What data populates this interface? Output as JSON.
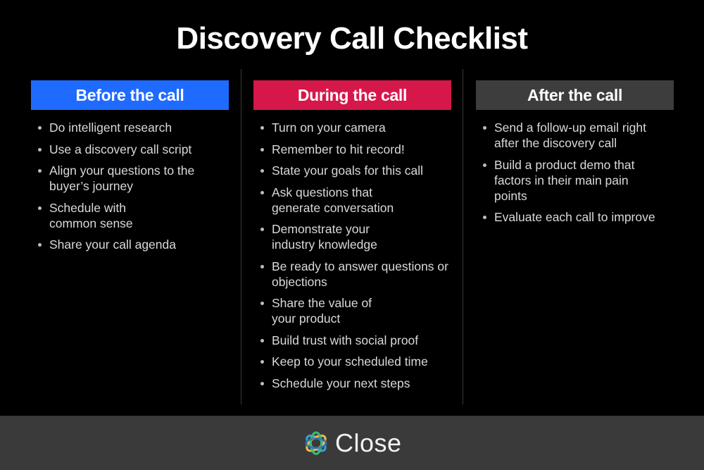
{
  "title": "Discovery Call Checklist",
  "colors": {
    "before": "#1f6bff",
    "during": "#d6174a",
    "after": "#3d3d3d",
    "footer": "#3a3a3a"
  },
  "columns": [
    {
      "heading": "Before the call",
      "items": [
        "Do intelligent research",
        "Use a discovery call script",
        "Align your questions to the buyer’s journey",
        "Schedule with common sense",
        "Share your call agenda"
      ]
    },
    {
      "heading": "During the call",
      "items": [
        "Turn on your camera",
        "Remember to hit record!",
        "State your goals for this call",
        "Ask questions that generate conversation",
        "Demonstrate your industry knowledge",
        "Be ready to answer questions or objections",
        "Share the value of your product",
        "Build trust with social proof",
        "Keep to your scheduled time",
        "Schedule your next steps"
      ]
    },
    {
      "heading": "After the call",
      "items": [
        "Send a follow-up email right after the discovery call",
        "Build a product demo that factors in their main pain points",
        "Evaluate each call to improve"
      ]
    }
  ],
  "footer": {
    "brand": "Close",
    "logo_icon": "close-logo-icon"
  }
}
